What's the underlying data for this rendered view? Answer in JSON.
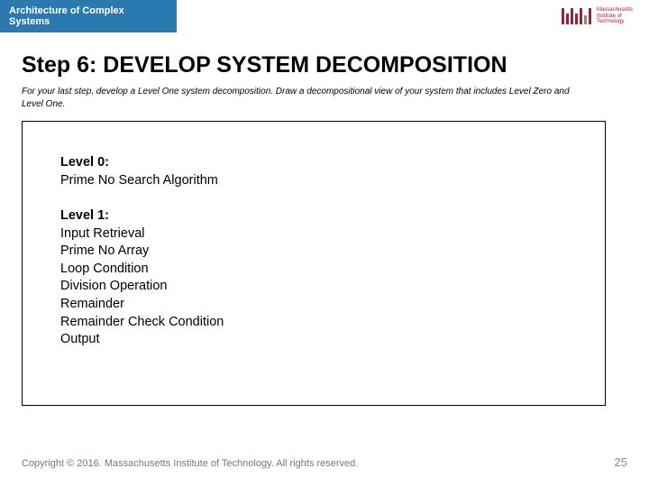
{
  "header": {
    "course_title": "Architecture of Complex Systems"
  },
  "logo": {
    "line1": "Massachusetts",
    "line2": "Institute of",
    "line3": "Technology"
  },
  "slide": {
    "title": "Step 6: DEVELOP SYSTEM DECOMPOSITION",
    "instruction": "For your last step, develop a Level One system decomposition. Draw a decompositional view of your system that includes Level Zero and Level One.",
    "level0": {
      "label": "Level 0:",
      "items": [
        "Prime No Search Algorithm"
      ]
    },
    "level1": {
      "label": "Level 1:",
      "items": [
        "Input Retrieval",
        "Prime No Array",
        "Loop Condition",
        "Division Operation",
        "Remainder",
        "Remainder Check Condition",
        "Output"
      ]
    }
  },
  "footer": {
    "copyright": "Copyright © 2016. Massachusetts Institute of Technology. All rights reserved.",
    "page_number": "25"
  }
}
